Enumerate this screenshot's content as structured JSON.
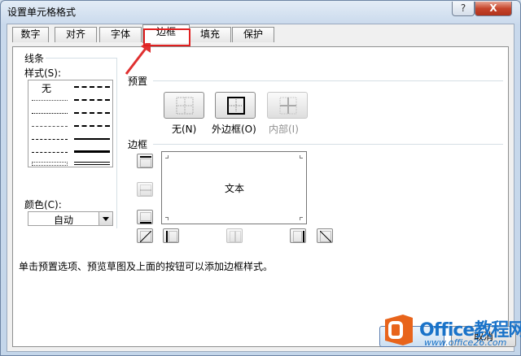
{
  "window": {
    "title": "设置单元格格式",
    "help_label": "?",
    "close_label": "X"
  },
  "tabs": [
    {
      "label": "数字"
    },
    {
      "label": "对齐"
    },
    {
      "label": "字体"
    },
    {
      "label": "边框",
      "active": true
    },
    {
      "label": "填充"
    },
    {
      "label": "保护"
    }
  ],
  "line": {
    "group_label": "线条",
    "style_label": "样式(S):",
    "none_label": "无",
    "color_label": "颜色(C):",
    "color_value": "自动"
  },
  "presets": {
    "group_label": "预置",
    "none_label": "无(N)",
    "outline_label": "外边框(O)",
    "inside_label": "内部(I)"
  },
  "border": {
    "group_label": "边框",
    "preview_text": "文本"
  },
  "hint": "单击预置选项、预览草图及上面的按钮可以添加边框样式。",
  "footer": {
    "cancel_label": "取消"
  },
  "watermark": {
    "brand": "Office教程网",
    "url": "www.office26.com"
  },
  "colors": {
    "highlight_box": "#e02020",
    "arrow": "#e03030",
    "logo": "#e8641b",
    "brand_text": "#1a73c9"
  }
}
